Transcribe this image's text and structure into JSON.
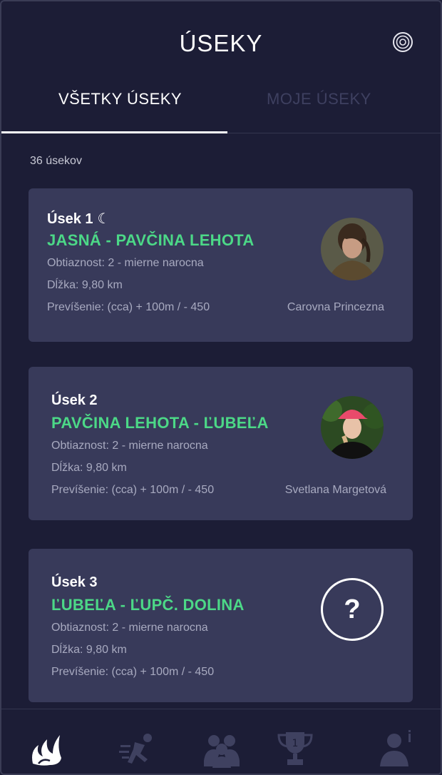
{
  "header": {
    "title": "ÚSEKY"
  },
  "tabs": [
    {
      "label": "VŠETKY ÚSEKY"
    },
    {
      "label": "MOJE ÚSEKY"
    }
  ],
  "count_label": "36 úsekov",
  "sections": [
    {
      "label": "Úsek 1",
      "has_night_icon": true,
      "route": "JASNÁ - PAVČINA LEHOTA",
      "difficulty": "Obtiaznost: 2 - mierne narocna",
      "length": "Dĺžka: 9,80 km",
      "elevation": "Prevíšenie: (cca) + 100m / - 450",
      "runner": "Carovna Princezna"
    },
    {
      "label": "Úsek 2",
      "has_night_icon": false,
      "route": "PAVČINA LEHOTA - ĽUBEĽA",
      "difficulty": "Obtiaznost: 2 - mierne narocna",
      "length": "Dĺžka: 9,80 km",
      "elevation": "Prevíšenie: (cca) + 100m / - 450",
      "runner": "Svetlana Margetová"
    },
    {
      "label": "Úsek 3",
      "has_night_icon": false,
      "route": "ĽUBEĽA - ĽUPČ. DOLINA",
      "difficulty": "Obtiaznost: 2 - mierne narocna",
      "length": "Dĺžka: 9,80 km",
      "elevation": "Prevíšenie: (cca) + 100m / - 450",
      "runner": "",
      "placeholder_avatar": "?"
    }
  ],
  "nav": [
    {
      "icon": "logo-icon",
      "active": true
    },
    {
      "icon": "runner-icon",
      "active": false
    },
    {
      "icon": "team-icon",
      "active": false
    },
    {
      "icon": "trophy-icon",
      "active": false
    },
    {
      "icon": "profile-info-icon",
      "active": false
    }
  ],
  "colors": {
    "background": "#1c1d36",
    "card": "#383a5a",
    "accent_green": "#4cd887",
    "muted_text": "#a8aac0"
  }
}
